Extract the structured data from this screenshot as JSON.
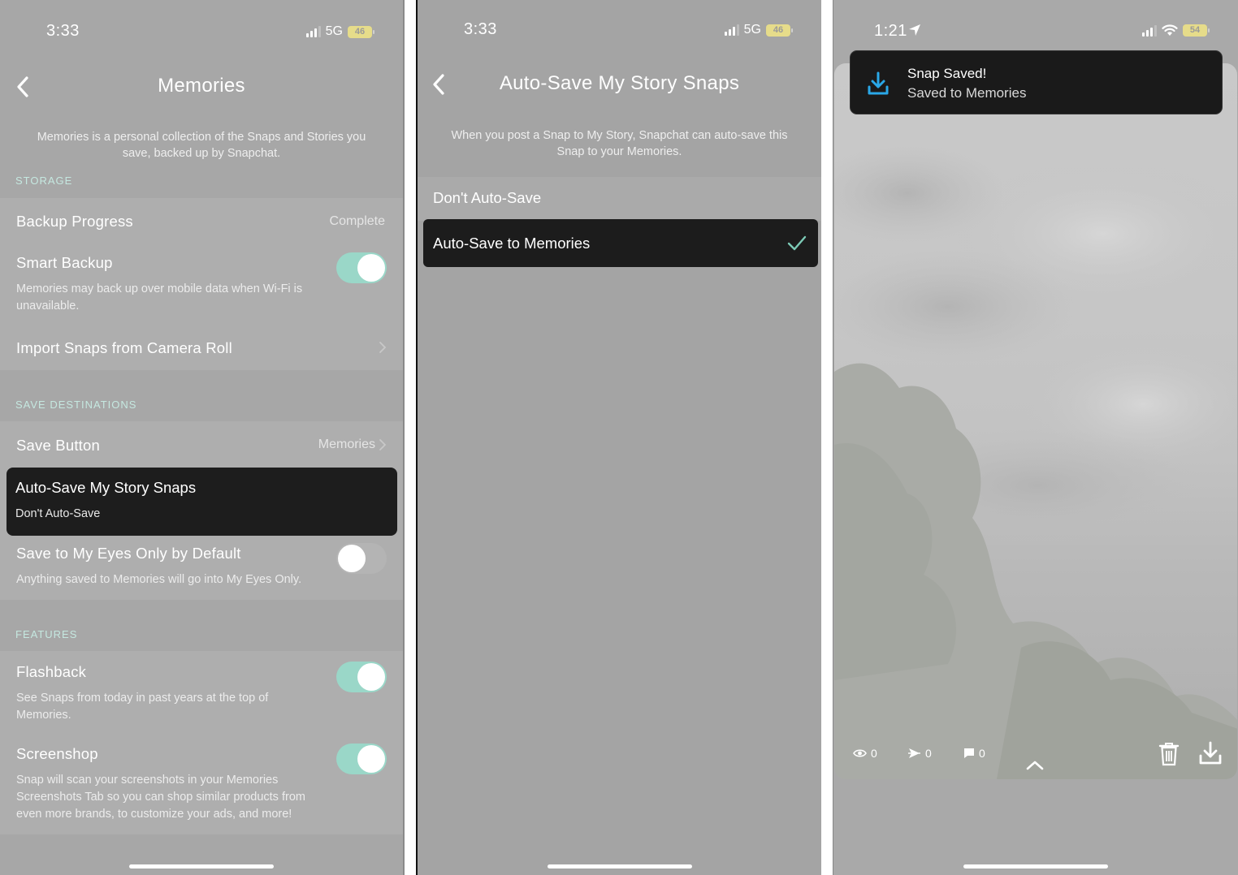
{
  "panel1": {
    "status": {
      "time": "3:33",
      "network": "5G",
      "battery": "46"
    },
    "title": "Memories",
    "description": "Memories is a personal collection of the Snaps and Stories you save, backed up by Snapchat.",
    "storage_label": "STORAGE",
    "backup_progress": {
      "label": "Backup Progress",
      "value": "Complete"
    },
    "smart_backup": {
      "label": "Smart Backup",
      "sub": "Memories may back up over mobile data when Wi-Fi is unavailable.",
      "on": true
    },
    "import": {
      "label": "Import Snaps from Camera Roll"
    },
    "save_destinations_label": "SAVE DESTINATIONS",
    "save_button": {
      "label": "Save Button",
      "value": "Memories"
    },
    "auto_save": {
      "label": "Auto-Save My Story Snaps",
      "value": "Don't Auto-Save"
    },
    "my_eyes_only": {
      "label": "Save to My Eyes Only by Default",
      "sub": "Anything saved to Memories will go into My Eyes Only.",
      "on": false
    },
    "features_label": "FEATURES",
    "flashback": {
      "label": "Flashback",
      "sub": "See Snaps from today in past years at the top of Memories.",
      "on": true
    },
    "screenshop": {
      "label": "Screenshop",
      "sub": "Snap will scan your screenshots in your Memories Screenshots Tab so you can shop similar products from even more brands, to customize your ads, and more!",
      "on": true
    }
  },
  "panel2": {
    "status": {
      "time": "3:33",
      "network": "5G",
      "battery": "46"
    },
    "title": "Auto-Save My Story Snaps",
    "description": "When you post a Snap to My Story, Snapchat can auto-save this Snap to your Memories.",
    "options": [
      "Don't Auto-Save",
      "Auto-Save to Memories"
    ],
    "selected_index": 1
  },
  "panel3": {
    "status": {
      "time": "1:21",
      "battery": "54"
    },
    "toast": {
      "title": "Snap Saved!",
      "subtitle": "Saved to Memories"
    },
    "stats": {
      "views": "0",
      "screenshots": "0",
      "replies": "0"
    }
  },
  "colors": {
    "accent": "#9ad7c8",
    "highlight_bg": "#1d1d1d",
    "toast_icon": "#2aa8e8"
  }
}
